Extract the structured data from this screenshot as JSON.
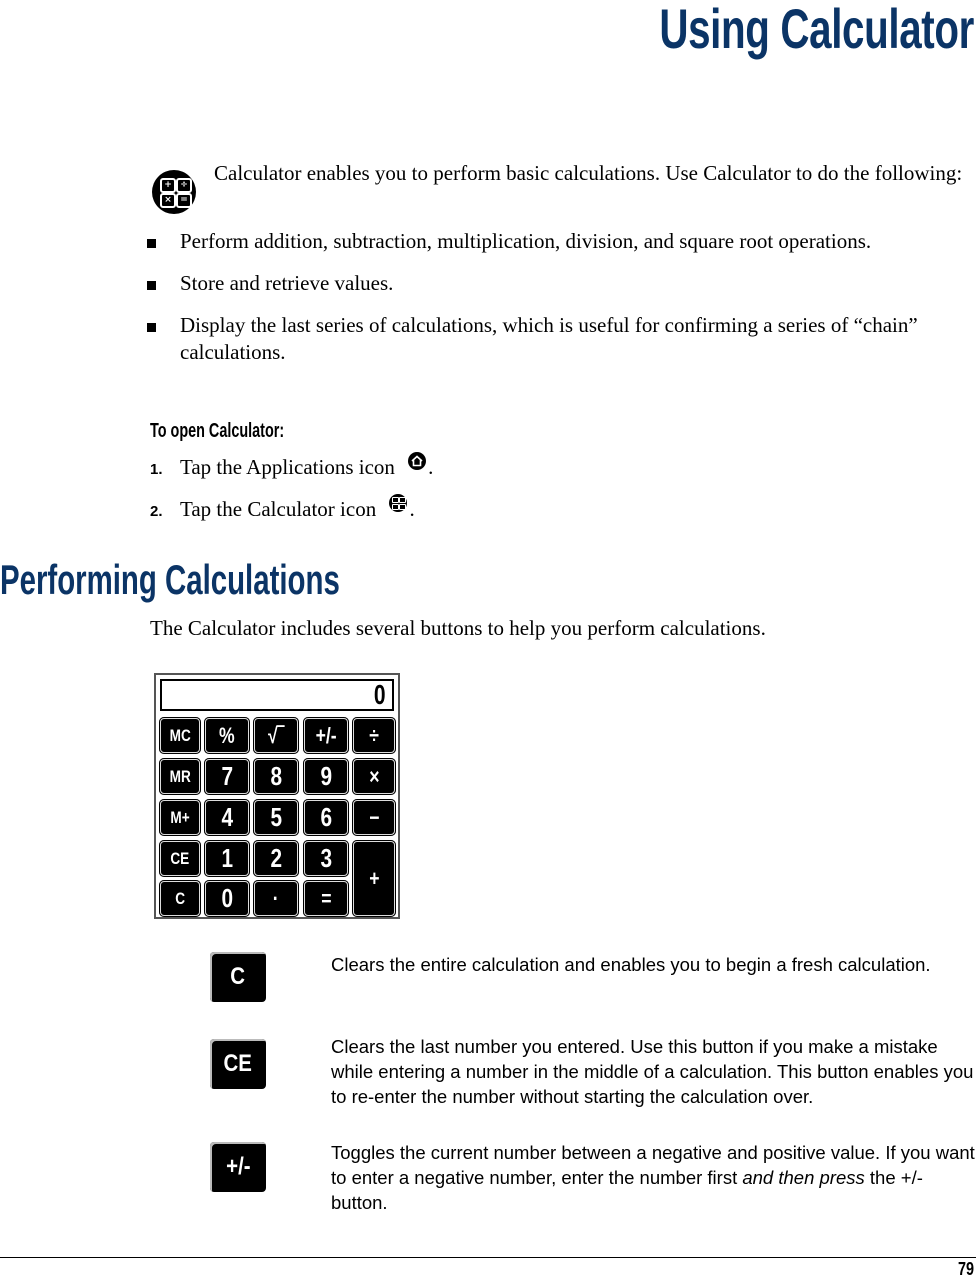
{
  "chapter": {
    "title": "Using Calculator"
  },
  "intro": {
    "icon": "calculator-app-icon",
    "text": "Calculator enables you to perform basic calculations. Use Calculator to do the following:"
  },
  "features": [
    "Perform addition, subtraction, multiplication, division, and square root operations.",
    "Store and retrieve values.",
    "Display the last series of calculations, which is useful for confirming a series of “chain” calculations."
  ],
  "procedure": {
    "heading": "To open Calculator:",
    "steps": [
      {
        "number": "1.",
        "text": "Tap the Applications icon",
        "icon": "home-icon",
        "suffix": "."
      },
      {
        "number": "2.",
        "text": "Tap the  Calculator icon",
        "icon": "calculator-icon",
        "suffix": "."
      }
    ]
  },
  "section": {
    "heading": "Performing Calculations",
    "intro": "The Calculator includes several buttons to help you perform calculations."
  },
  "calculator": {
    "display_value": "0",
    "keys": [
      {
        "label": "MC",
        "name": "memory-clear"
      },
      {
        "label": "%",
        "name": "percent"
      },
      {
        "label": "√‾",
        "name": "square-root"
      },
      {
        "label": "+/-",
        "name": "plus-minus"
      },
      {
        "label": "÷",
        "name": "divide"
      },
      {
        "label": "MR",
        "name": "memory-recall"
      },
      {
        "label": "7",
        "name": "digit-7"
      },
      {
        "label": "8",
        "name": "digit-8"
      },
      {
        "label": "9",
        "name": "digit-9"
      },
      {
        "label": "×",
        "name": "multiply"
      },
      {
        "label": "M+",
        "name": "memory-add"
      },
      {
        "label": "4",
        "name": "digit-4"
      },
      {
        "label": "5",
        "name": "digit-5"
      },
      {
        "label": "6",
        "name": "digit-6"
      },
      {
        "label": "−",
        "name": "subtract"
      },
      {
        "label": "CE",
        "name": "clear-entry"
      },
      {
        "label": "1",
        "name": "digit-1"
      },
      {
        "label": "2",
        "name": "digit-2"
      },
      {
        "label": "3",
        "name": "digit-3"
      },
      {
        "label": "+",
        "name": "add"
      },
      {
        "label": "C",
        "name": "clear"
      },
      {
        "label": "0",
        "name": "digit-0"
      },
      {
        "label": "·",
        "name": "decimal"
      },
      {
        "label": "=",
        "name": "equals"
      }
    ]
  },
  "descriptions": [
    {
      "key_label": "C",
      "text": "Clears the entire calculation and enables you to begin a fresh calculation."
    },
    {
      "key_label": "CE",
      "text": "Clears the last number you entered. Use this button if you make a mistake while entering a number in the middle of a calculation. This button enables you to re-enter the number without starting the calculation over."
    },
    {
      "key_label": "+/-",
      "text_before": "Toggles the current number between a negative and positive value. If you want to enter a negative number, enter the number first ",
      "text_emphasis": "and then press",
      "text_after": " the +/- button."
    }
  ],
  "footer": {
    "page_number": "79"
  },
  "colors": {
    "heading": "#0b3466"
  }
}
